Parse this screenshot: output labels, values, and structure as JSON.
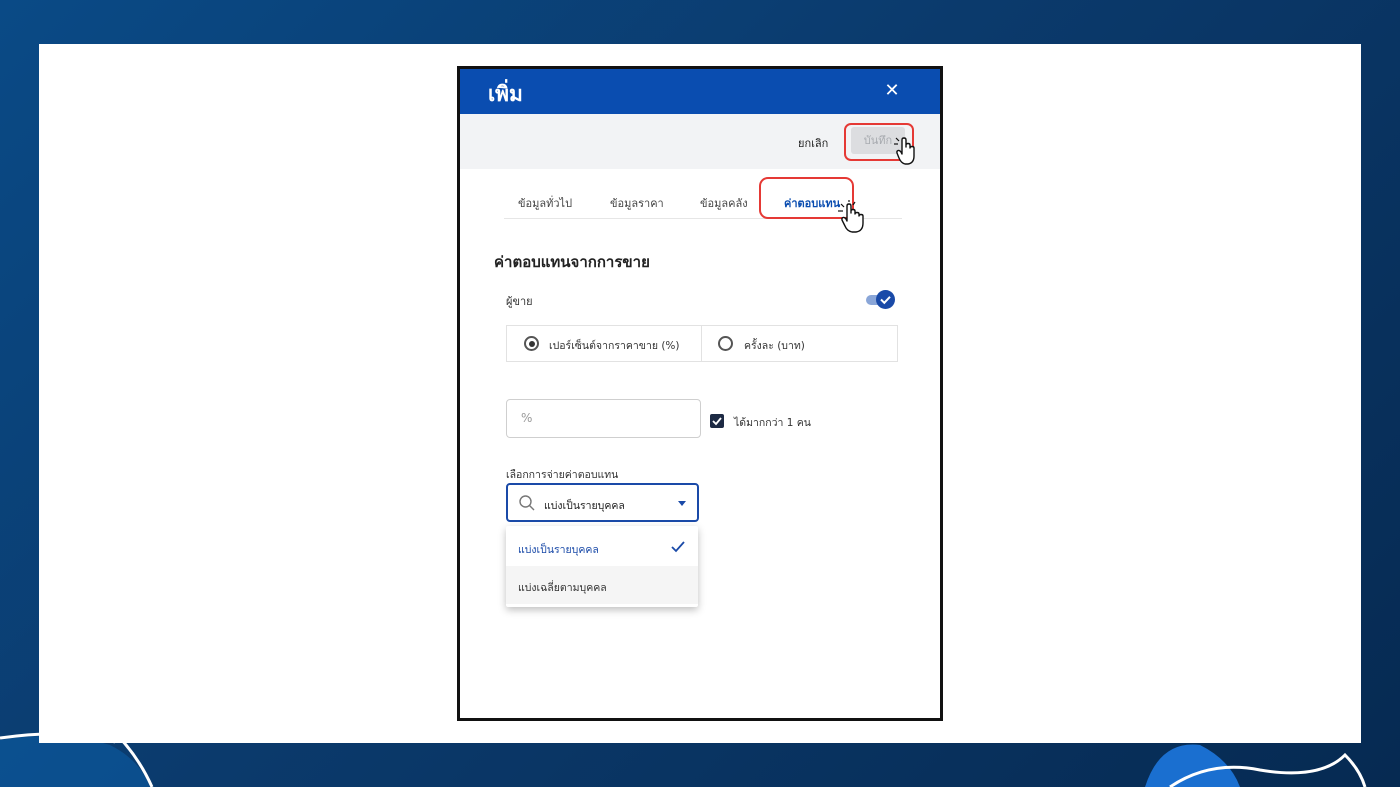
{
  "dialog": {
    "title": "เพิ่ม",
    "close_icon": "close-icon"
  },
  "actions": {
    "cancel_label": "ยกเลิก",
    "save_label": "บันทึก"
  },
  "tabs": [
    {
      "label": "ข้อมูลทั่วไป",
      "active": false
    },
    {
      "label": "ข้อมูลราคา",
      "active": false
    },
    {
      "label": "ข้อมูลคลัง",
      "active": false
    },
    {
      "label": "ค่าตอบแทน",
      "active": true
    }
  ],
  "section": {
    "title": "ค่าตอบแทนจากการขาย",
    "seller_label": "ผู้ขาย",
    "seller_toggle_on": true
  },
  "radio": {
    "option1": "เปอร์เซ็นต์จากราคาขาย (%)",
    "option2": "ครั้งละ (บาท)",
    "selected": "option1"
  },
  "percent_input": {
    "placeholder": "%",
    "value": ""
  },
  "multi_checkbox": {
    "label": "ได้มากกว่า 1 คน",
    "checked": true
  },
  "payout": {
    "label": "เลือกการจ่ายค่าตอบแทน",
    "selected": "แบ่งเป็นรายบุคคล",
    "options": [
      "แบ่งเป็นรายบุคคล",
      "แบ่งเฉลี่ยตามบุคคล"
    ]
  },
  "colors": {
    "header": "#0a4db0",
    "highlight": "#e53935",
    "background": "#0b3a6c"
  }
}
